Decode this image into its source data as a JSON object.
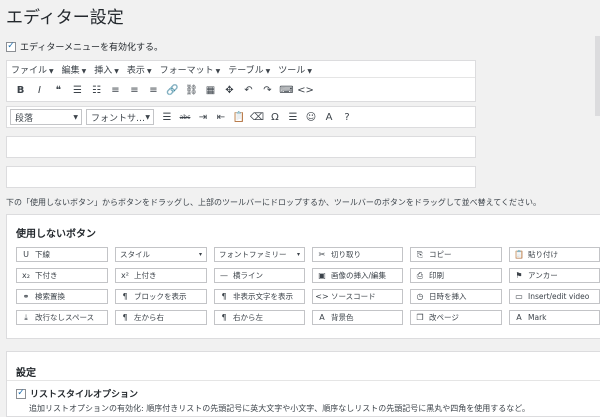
{
  "page": {
    "title": "エディター設定"
  },
  "enable": {
    "label": "エディターメニューを有効化する。",
    "checked": "✓"
  },
  "menubar": [
    {
      "label": "ファイル"
    },
    {
      "label": "編集"
    },
    {
      "label": "挿入"
    },
    {
      "label": "表示"
    },
    {
      "label": "フォーマット"
    },
    {
      "label": "テーブル"
    },
    {
      "label": "ツール"
    }
  ],
  "toolbar1": [
    {
      "name": "bold",
      "glyph": "B"
    },
    {
      "name": "italic",
      "glyph": "I"
    },
    {
      "name": "blockquote",
      "glyph": "❝"
    },
    {
      "name": "bullet-list",
      "glyph": "☰"
    },
    {
      "name": "numbered-list",
      "glyph": "☷"
    },
    {
      "name": "align-left",
      "glyph": "≡"
    },
    {
      "name": "align-center",
      "glyph": "≡"
    },
    {
      "name": "align-right",
      "glyph": "≡"
    },
    {
      "name": "link",
      "glyph": "🔗"
    },
    {
      "name": "unlink",
      "glyph": "⛓"
    },
    {
      "name": "table",
      "glyph": "▦"
    },
    {
      "name": "fullscreen",
      "glyph": "✥"
    },
    {
      "name": "undo",
      "glyph": "↶"
    },
    {
      "name": "redo",
      "glyph": "↷"
    },
    {
      "name": "keyboard",
      "glyph": "⌨"
    },
    {
      "name": "code",
      "glyph": "<>"
    }
  ],
  "toolbar2": {
    "format_select": "段落",
    "font_select": "フォントサ…",
    "buttons": [
      {
        "name": "justify",
        "glyph": "☰"
      },
      {
        "name": "strikethrough",
        "glyph": "abc"
      },
      {
        "name": "indent",
        "glyph": "⇥"
      },
      {
        "name": "outdent",
        "glyph": "⇤"
      },
      {
        "name": "paste-text",
        "glyph": "📋"
      },
      {
        "name": "clear-format",
        "glyph": "⌫"
      },
      {
        "name": "omega",
        "glyph": "Ω"
      },
      {
        "name": "horizontal-line",
        "glyph": "☰"
      },
      {
        "name": "emoji",
        "glyph": "☺"
      },
      {
        "name": "text-color",
        "glyph": "A"
      },
      {
        "name": "help",
        "glyph": "?"
      }
    ]
  },
  "instruction": "下の「使用しないボタン」からボタンをドラッグし、上部のツールバーにドロップするか、ツールバーのボタンをドラッグして並べ替えてください。",
  "unused": {
    "title": "使用しないボタン",
    "rows": [
      [
        {
          "icon": "U",
          "label": "下線",
          "caret": ""
        },
        {
          "icon": "",
          "label": "スタイル",
          "caret": "▾"
        },
        {
          "icon": "",
          "label": "フォントファミリー",
          "caret": "▾"
        },
        {
          "icon": "✂",
          "label": "切り取り",
          "caret": ""
        },
        {
          "icon": "⎘",
          "label": "コピー",
          "caret": ""
        },
        {
          "icon": "📋",
          "label": "貼り付け",
          "caret": ""
        }
      ],
      [
        {
          "icon": "x₂",
          "label": "下付き",
          "caret": ""
        },
        {
          "icon": "x²",
          "label": "上付き",
          "caret": ""
        },
        {
          "icon": "—",
          "label": "横ライン",
          "caret": ""
        },
        {
          "icon": "▣",
          "label": "画像の挿入/編集",
          "caret": ""
        },
        {
          "icon": "⎙",
          "label": "印刷",
          "caret": ""
        },
        {
          "icon": "⚑",
          "label": "アンカー",
          "caret": ""
        }
      ],
      [
        {
          "icon": "⚭",
          "label": "検索置換",
          "caret": ""
        },
        {
          "icon": "¶",
          "label": "ブロックを表示",
          "caret": ""
        },
        {
          "icon": "¶",
          "label": "非表示文字を表示",
          "caret": ""
        },
        {
          "icon": "<>",
          "label": "ソースコード",
          "caret": ""
        },
        {
          "icon": "◷",
          "label": "日時を挿入",
          "caret": ""
        },
        {
          "icon": "▭",
          "label": "Insert/edit video",
          "caret": ""
        }
      ],
      [
        {
          "icon": "⤓",
          "label": "改行なしスペース",
          "caret": ""
        },
        {
          "icon": "¶",
          "label": "左から右",
          "caret": ""
        },
        {
          "icon": "¶",
          "label": "右から左",
          "caret": ""
        },
        {
          "icon": "A",
          "label": "背景色",
          "caret": ""
        },
        {
          "icon": "❐",
          "label": "改ページ",
          "caret": ""
        },
        {
          "icon": "A",
          "label": "Mark",
          "caret": ""
        }
      ]
    ]
  },
  "settings": {
    "title": "設定",
    "option_label": "リストスタイルオプション",
    "option_checked": "✓",
    "option_desc": "追加リストオプションの有効化: 順序付きリストの先頭記号に英大文字や小文字、順序なしリストの先頭記号に黒丸や四角を使用するなど。"
  }
}
